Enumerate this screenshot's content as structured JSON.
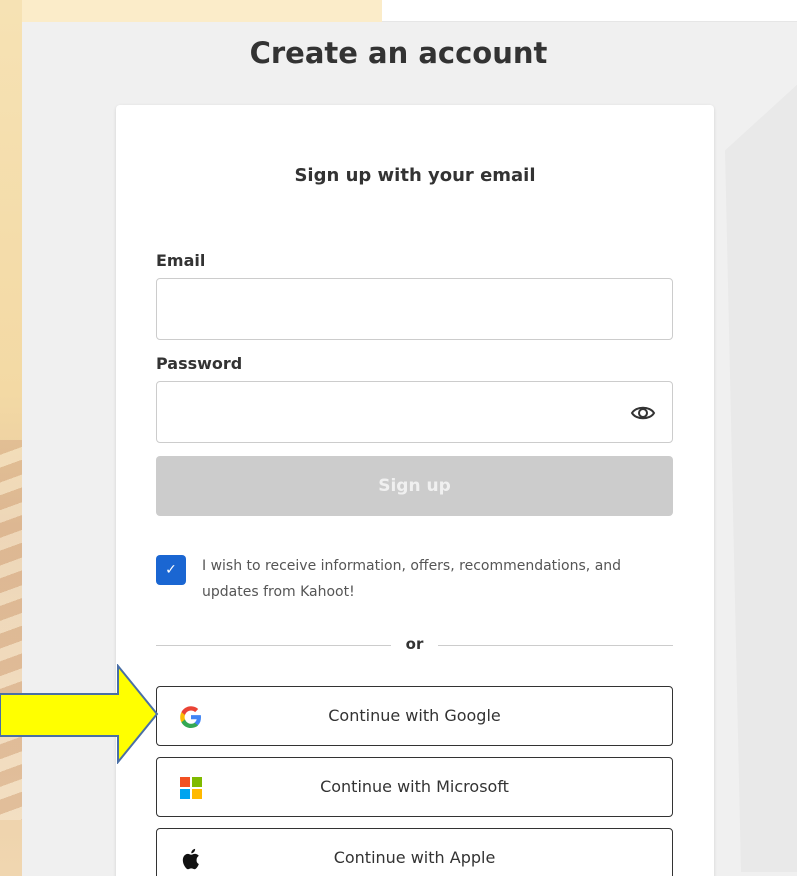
{
  "page": {
    "title": "Create an account"
  },
  "form": {
    "heading": "Sign up with your email",
    "email_label": "Email",
    "email_value": "",
    "password_label": "Password",
    "password_value": "",
    "signup_label": "Sign up",
    "consent_checked": true,
    "consent_text": "I wish to receive information, offers, recommendations, and updates from Kahoot!"
  },
  "divider_text": "or",
  "social": [
    {
      "label": "Continue with Google",
      "icon": "google-icon"
    },
    {
      "label": "Continue with Microsoft",
      "icon": "microsoft-icon"
    },
    {
      "label": "Continue with Apple",
      "icon": "apple-icon"
    }
  ],
  "colors": {
    "accent": "#1a66d2",
    "disabled_button": "#cccccc",
    "arrow_fill": "#ffff00",
    "arrow_stroke": "#4a6fa5"
  }
}
